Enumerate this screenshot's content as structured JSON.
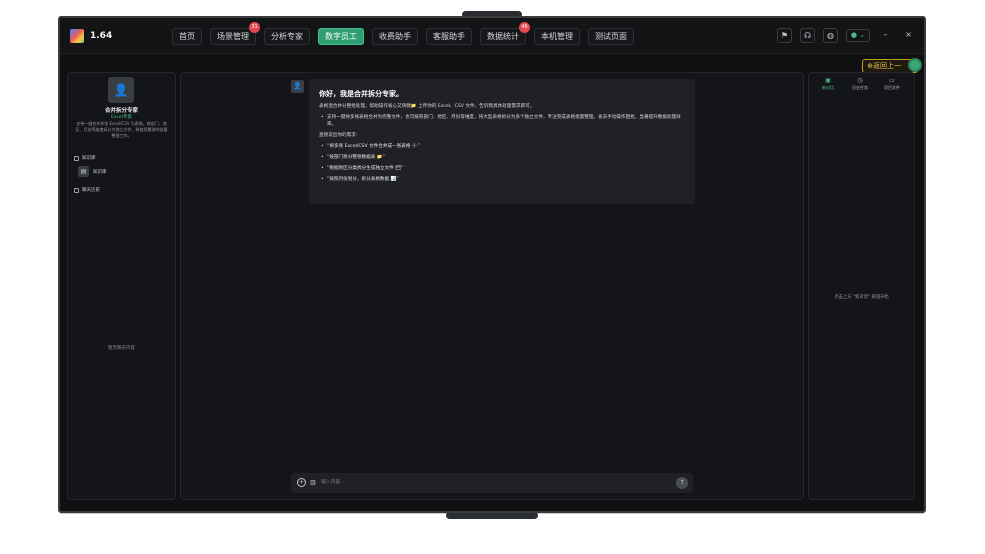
{
  "app": {
    "version": "1.64"
  },
  "tabs": [
    {
      "label": "首页",
      "active": false,
      "badge": ""
    },
    {
      "label": "场景管理",
      "active": false,
      "badge": "31"
    },
    {
      "label": "分析专家",
      "active": false,
      "badge": ""
    },
    {
      "label": "数字员工",
      "active": true,
      "badge": ""
    },
    {
      "label": "收费助手",
      "active": false,
      "badge": ""
    },
    {
      "label": "客服助手",
      "active": false,
      "badge": ""
    },
    {
      "label": "数据统计",
      "active": false,
      "badge": "46"
    },
    {
      "label": "本机管理",
      "active": false,
      "badge": ""
    },
    {
      "label": "测试页面",
      "active": false,
      "badge": ""
    }
  ],
  "topbar_icons": [
    "flag-icon",
    "headset-icon",
    "globe-icon",
    "user-icon",
    "minimize-icon",
    "close-icon"
  ],
  "window": {
    "minimize": "–",
    "close": "×",
    "user_caret": "⌄"
  },
  "return_button": {
    "label": "返回上一"
  },
  "agent": {
    "name": "合并拆分专家",
    "subtitle": "Excel专家",
    "description": "支持一键合并多张 Excel/CSV 为表格，按部门、地区、月份等维度拆分为独立文件，释放您繁琐的批量整理工作。"
  },
  "left_sections": {
    "knowledge": "知识库",
    "kb_item": "知识库",
    "history": "聊天历史",
    "empty": "暂无聊天内容"
  },
  "message": {
    "title": "你好，我是合并拆分专家。",
    "intro": "表格混合并分整批处理，帮助操作省心又快捷📁 上传你的 Excel、CSV 文件，告诉我具体处理需求即可。",
    "bullet1": "支持一键将多张表格合并为完整文件，也可按照部门、地区、月份等维度，将大型表格拆分为多个独立文件，专注完成表格批量整理，省去手动操作困扰，显著提升数据处理效率。",
    "prompt": "直接说出你的需求：",
    "examples": [
      "“将多张 Excel/CSV 文件合并成一张表格 ➕”",
      "“按部门拆分整张数据表 📁”",
      "“根据地区分类拆分生成独立文件 🗂”",
      "“按照月份划分，拆分表格数据 📊”"
    ]
  },
  "input": {
    "placeholder": "输入内容..."
  },
  "right_tabs": [
    {
      "label": "新对话",
      "icon": "new-chat-icon",
      "active": true
    },
    {
      "label": "历史任务",
      "icon": "history-icon",
      "active": false
    },
    {
      "label": "项目文件",
      "icon": "folder-icon",
      "active": false
    }
  ],
  "right_empty": "点击上方 “新对话” 按钮开始",
  "colors": {
    "accent": "#45c08d",
    "badge": "#e5484d",
    "return": "#f2c14e"
  }
}
